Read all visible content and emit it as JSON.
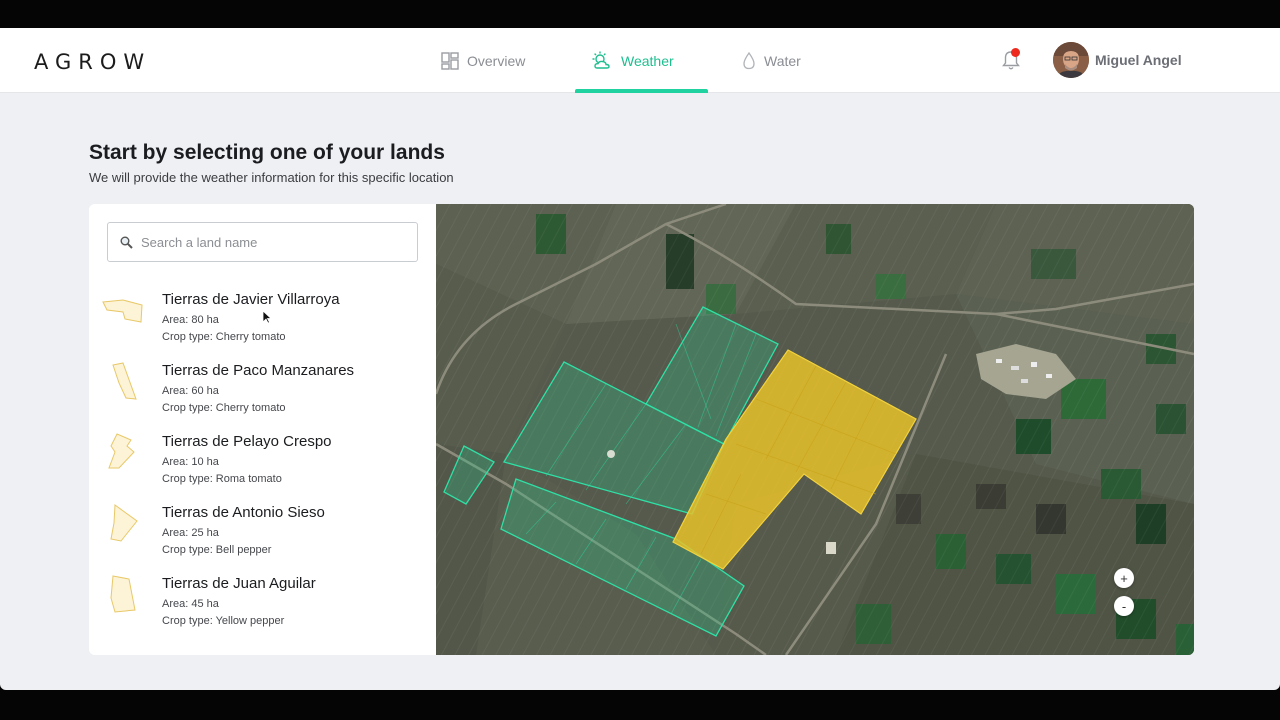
{
  "header": {
    "logo": "AGROW",
    "nav": [
      {
        "label": "Overview",
        "icon": "dashboard-icon",
        "active": false
      },
      {
        "label": "Weather",
        "icon": "sun-cloud-icon",
        "active": true
      },
      {
        "label": "Water",
        "icon": "water-drop-icon",
        "active": false
      }
    ],
    "notifications_unread": true,
    "user": {
      "name": "Miguel Angel"
    }
  },
  "page": {
    "title": "Start by selecting one of your lands",
    "subtitle": "We will provide the weather information for this specific location"
  },
  "search": {
    "placeholder": "Search a land name",
    "value": ""
  },
  "lands": [
    {
      "name": "Tierras de Javier Villarroya",
      "area": "Area: 80 ha",
      "crop": "Crop type: Cherry tomato"
    },
    {
      "name": "Tierras de Paco Manzanares",
      "area": "Area: 60 ha",
      "crop": "Crop type: Cherry tomato"
    },
    {
      "name": "Tierras de Pelayo Crespo",
      "area": "Area: 10 ha",
      "crop": "Crop type: Roma tomato"
    },
    {
      "name": "Tierras de Antonio Sieso",
      "area": "Area: 25 ha",
      "crop": "Crop type: Bell pepper"
    },
    {
      "name": "Tierras de Juan Aguilar",
      "area": "Area: 45 ha",
      "crop": "Crop type: Yellow pepper"
    }
  ],
  "map": {
    "zoom_in": "+",
    "zoom_out": "-"
  },
  "colors": {
    "accent": "#1fbe8f",
    "field_highlight": "#e7c22a",
    "field_outline": "#2fe0a6",
    "notification": "#ee2a1f"
  }
}
